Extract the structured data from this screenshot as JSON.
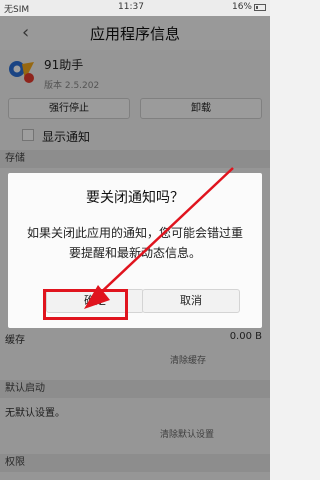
{
  "status_bar": {
    "carrier": "无SIM",
    "time": "11:37",
    "battery": "16%"
  },
  "header": {
    "back_icon": "chevron-left-icon",
    "title": "应用程序信息"
  },
  "app": {
    "name": "91助手",
    "version": "版本 2.5.202"
  },
  "actions": {
    "force_stop": "强行停止",
    "uninstall": "卸载"
  },
  "notifications": {
    "show_label": "显示通知",
    "checked": true
  },
  "storage": {
    "header": "存储",
    "cache_label": "缓存",
    "cache_value": "0.00 B",
    "clear_cache": "清除缓存"
  },
  "default_launch": {
    "header": "默认启动",
    "value": "无默认设置。",
    "clear_defaults": "清除默认设置"
  },
  "permissions": {
    "header": "权限"
  },
  "dialog": {
    "title": "要关闭通知吗？",
    "message": "如果关闭此应用的通知，您可能会错过重要提醒和最新动态信息。",
    "confirm": "确定",
    "cancel": "取消"
  },
  "colors": {
    "highlight": "#e0141e",
    "arrow": "#e0141e"
  }
}
